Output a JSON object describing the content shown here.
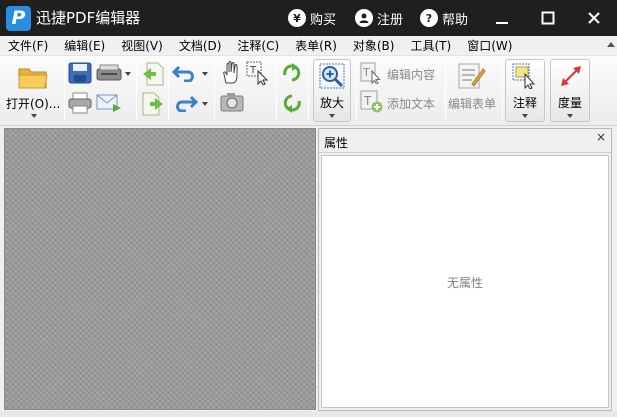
{
  "app": {
    "title": "迅捷PDF编辑器",
    "logo_letter": "P"
  },
  "titlebar": {
    "buy": {
      "icon": "¥",
      "label": "购买"
    },
    "register": {
      "icon": "user-icon",
      "label": "注册"
    },
    "help": {
      "icon": "?",
      "label": "帮助"
    }
  },
  "menu": [
    "文件(F)",
    "编辑(E)",
    "视图(V)",
    "文档(D)",
    "注释(C)",
    "表单(R)",
    "对象(B)",
    "工具(T)",
    "窗口(W)"
  ],
  "toolbar": {
    "open": "打开(O)...",
    "zoom": "放大",
    "edit_content": "编辑内容",
    "add_text": "添加文本",
    "edit_form": "编辑表单",
    "annotate": "注释",
    "measure": "度量"
  },
  "panel": {
    "title": "属性",
    "close": "×",
    "empty_text": "无属性"
  },
  "colors": {
    "titlebar": "#1f1f1f",
    "logo": "#2a8ee0",
    "canvas": "#9c9c9c",
    "accent_green": "#5aaa3a",
    "accent_blue": "#3a7fd0"
  }
}
